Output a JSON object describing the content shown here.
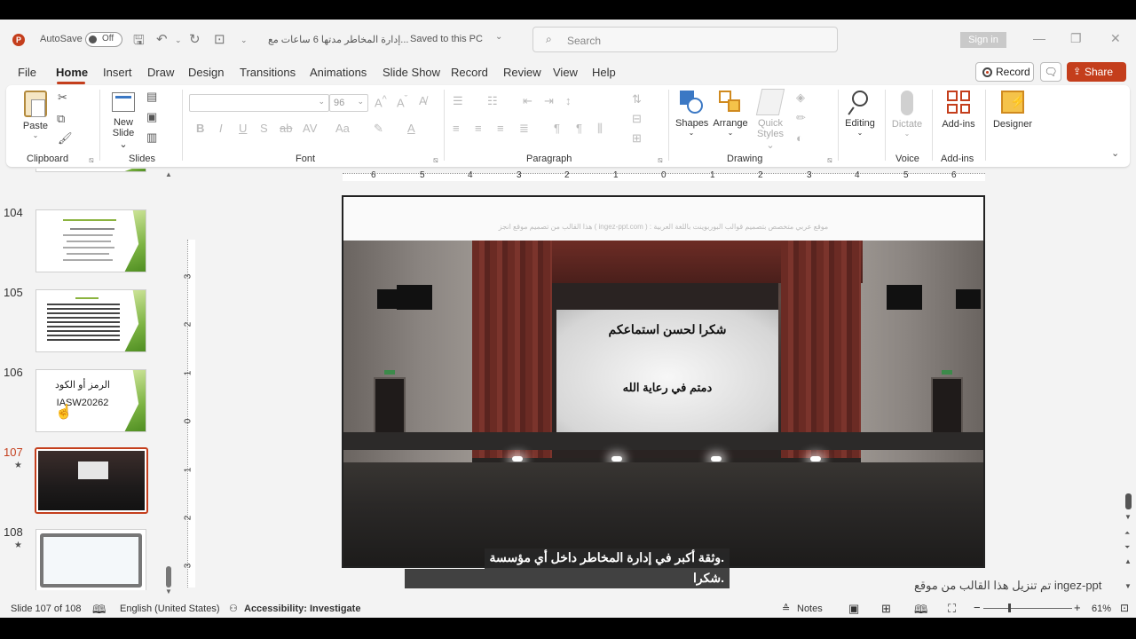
{
  "titlebar": {
    "app_icon": "powerpoint-icon",
    "autosave_label": "AutoSave",
    "autosave_state": "Off",
    "doc_title": "إدارة المخاطر مدتها 6 ساعات مع...",
    "saved_status": "Saved to this PC",
    "search_placeholder": "Search",
    "signin_label": "Sign in"
  },
  "menu": {
    "tabs": [
      "File",
      "Home",
      "Insert",
      "Draw",
      "Design",
      "Transitions",
      "Animations",
      "Slide Show",
      "Record",
      "Review",
      "View",
      "Help"
    ],
    "active_tab": "Home",
    "record_label": "Record",
    "share_label": "Share"
  },
  "ribbon": {
    "paste_label": "Paste",
    "new_slide_label": "New",
    "new_slide_label2": "Slide",
    "font_size": "96",
    "shapes_label": "Shapes",
    "arrange_label": "Arrange",
    "quick_styles_label": "Quick",
    "quick_styles_label2": "Styles",
    "editing_label": "Editing",
    "dictate_label": "Dictate",
    "addins_label": "Add-ins",
    "designer_label": "Designer",
    "groups": {
      "clipboard": "Clipboard",
      "slides": "Slides",
      "font": "Font",
      "paragraph": "Paragraph",
      "drawing": "Drawing",
      "voice": "Voice",
      "addins": "Add-ins"
    }
  },
  "thumbnails": {
    "items": [
      {
        "num": "104",
        "kind": "text"
      },
      {
        "num": "105",
        "kind": "text"
      },
      {
        "num": "106",
        "kind": "code"
      },
      {
        "num": "107",
        "kind": "theater",
        "current": true
      },
      {
        "num": "108",
        "kind": "frame"
      }
    ],
    "slide106_line1": "الرمز أو الكود",
    "slide106_line2": "IASW20262",
    "star": "★"
  },
  "ruler": {
    "h_labels": [
      "6",
      "5",
      "4",
      "3",
      "2",
      "1",
      "0",
      "1",
      "2",
      "3",
      "4",
      "5",
      "6"
    ],
    "v_labels": [
      "3",
      "2",
      "1",
      "0",
      "1",
      "2",
      "3"
    ]
  },
  "slide": {
    "header_text": "هذا القالب من تصميم موقع انجز ( ingez-ppt.com ) : موقع عربي متخصص بتصميم قوالب البوربوينت باللغة العربية",
    "thanks_text": "شكرا لحسن استماعكم",
    "farewell_text": "دمتم في رعاية الله"
  },
  "caption": {
    "line1": ".وثقة أكبر في إدارة المخاطر داخل أي مؤسسة",
    "line2": ".شكرا"
  },
  "notes_text": "تم تنزيل هذا القالب من موقع ingez-ppt",
  "statusbar": {
    "slide_info": "Slide 107 of 108",
    "language": "English (United States)",
    "accessibility": "Accessibility: Investigate",
    "notes_label": "Notes",
    "zoom": "61%"
  },
  "colors": {
    "accent": "#c43e1c"
  }
}
